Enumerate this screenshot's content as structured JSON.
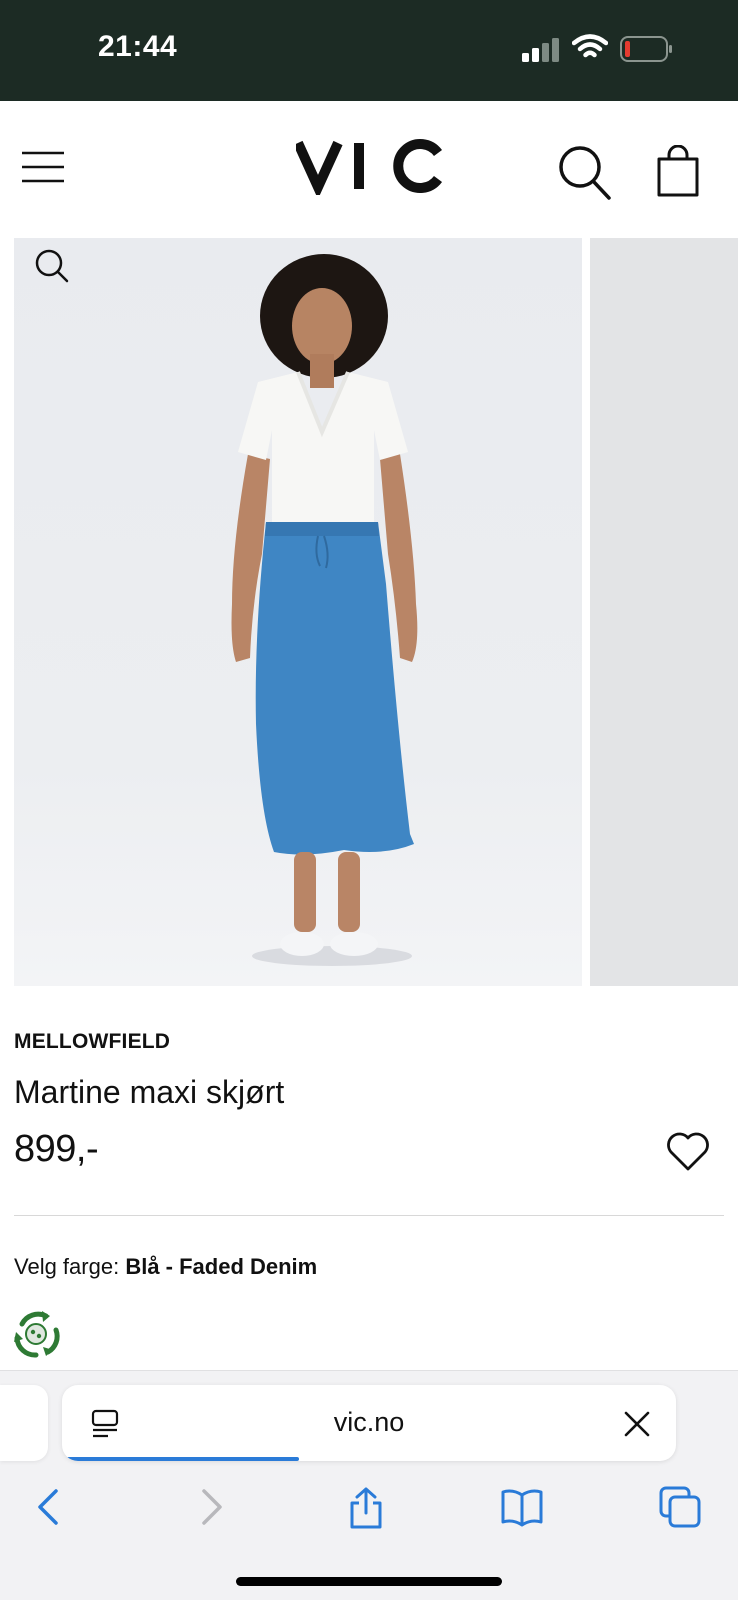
{
  "status_bar": {
    "time": "21:44",
    "icons": [
      "signal-icon",
      "wifi-icon",
      "battery-icon"
    ]
  },
  "header": {
    "logo": "VIC",
    "icons": [
      "menu-icon",
      "search-icon",
      "shopping-bag-icon"
    ]
  },
  "product": {
    "brand": "MELLOWFIELD",
    "name": "Martine maxi skjørt",
    "price": "899,-",
    "color_label": "Velg farge: ",
    "color_value": "Blå - Faded Denim"
  },
  "browser": {
    "url": "vic.no",
    "load_progress": 0.38,
    "toolbar_icons": [
      "back-icon",
      "forward-icon",
      "share-icon",
      "bookmarks-icon",
      "tabs-icon"
    ]
  },
  "colors": {
    "status_bar_bg": "#1c2b24",
    "skirt_denim": "#3f86c4",
    "accent_blue": "#2a7bd8",
    "eco_green": "#2e7a34"
  }
}
